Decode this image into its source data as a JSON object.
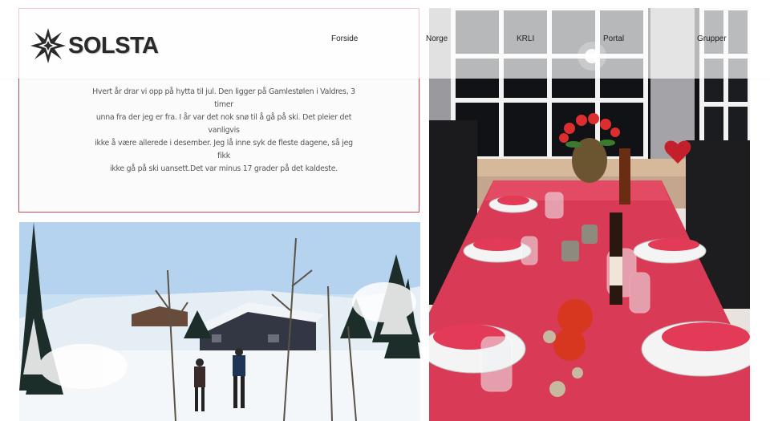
{
  "brand": {
    "name": "SOLSTA",
    "logo_icon": "star-burst-logo-icon"
  },
  "nav": {
    "items": [
      {
        "label": "Forside"
      },
      {
        "label": "Norge"
      },
      {
        "label": "KRLI"
      },
      {
        "label": "Portal"
      },
      {
        "label": "Grupper"
      }
    ]
  },
  "intro": {
    "lines": [
      "Hvert år drar vi opp på hytta til jul. Den ligger på Gamlestølen i Valdres, 3 timer",
      "unna fra der jeg er fra. I år var det nok snø til å gå på ski. Det pleier det vanligvis",
      "ikke å være allerede i desember. Jeg lå inne syk de fleste dagene, så jeg fikk",
      "ikke gå på ski uansett.Det var minus 17 grader på det kaldeste."
    ]
  },
  "colors": {
    "card_border": "#d2484f",
    "tablecloth": "#d93a55"
  },
  "images": {
    "right": "christmas-dinner-table-photo",
    "left": "snowy-cabin-skiers-photo"
  }
}
